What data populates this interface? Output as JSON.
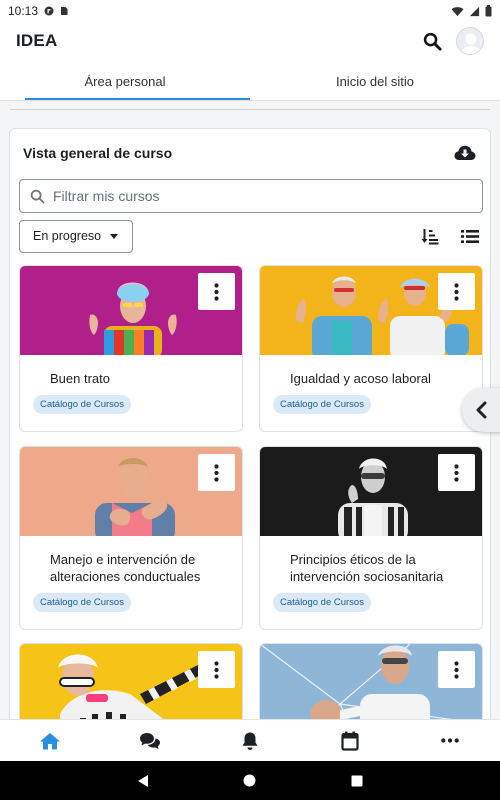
{
  "status_bar": {
    "time": "10:13"
  },
  "app_bar": {
    "title": "IDEA"
  },
  "tabs": [
    {
      "label": "Área personal",
      "active": true
    },
    {
      "label": "Inicio del sitio",
      "active": false
    }
  ],
  "overview": {
    "title": "Vista general de curso",
    "search_placeholder": "Filtrar mis cursos",
    "filter_selected": "En progreso"
  },
  "courses": [
    {
      "name": "Buen trato",
      "badge": "Catálogo de Cursos",
      "image_bg": "#b01f8a"
    },
    {
      "name": "Igualdad y acoso laboral",
      "badge": "Catálogo de Cursos",
      "image_bg": "#f3b31b"
    },
    {
      "name": "Manejo e intervención de alteraciones conductuales",
      "badge": "Catálogo de Cursos",
      "image_bg": "#eda98a"
    },
    {
      "name": "Principios éticos de la intervención sociosanitaria",
      "badge": "Catálogo de Cursos",
      "image_bg": "#1b1b1b"
    },
    {
      "name": "",
      "badge": "",
      "image_bg": "#f5c416"
    },
    {
      "name": "",
      "badge": "",
      "image_bg": "#8fb6d6"
    }
  ],
  "bottom_nav": {
    "items": [
      {
        "icon": "home-icon",
        "active": true
      },
      {
        "icon": "messages-icon",
        "active": false
      },
      {
        "icon": "bell-icon",
        "active": false
      },
      {
        "icon": "calendar-icon",
        "active": false
      },
      {
        "icon": "more-icon",
        "active": false
      }
    ]
  },
  "colors": {
    "accent": "#2b8ede",
    "badge_bg": "#dbeaf6",
    "badge_text": "#175f95"
  }
}
